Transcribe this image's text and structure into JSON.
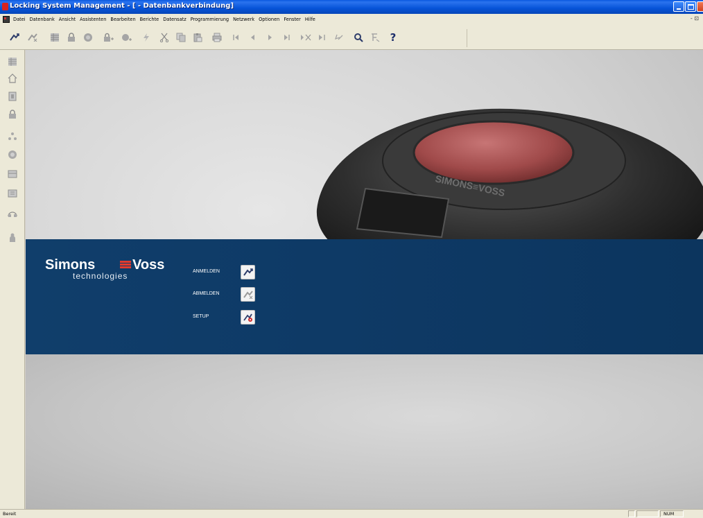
{
  "window": {
    "title": "Locking System Management - [ - Datenbankverbindung]"
  },
  "menu": {
    "items": [
      "Datei",
      "Datenbank",
      "Ansicht",
      "Assistenten",
      "Bearbeiten",
      "Berichte",
      "Datensatz",
      "Programmierung",
      "Netzwerk",
      "Optionen",
      "Fenster",
      "Hilfe"
    ],
    "window_controls": "- ⊡"
  },
  "toolbar": {
    "icons": [
      "login-icon",
      "logout-icon",
      "locking-plan-icon",
      "lock-icon",
      "transponder-icon",
      "new-lock-icon",
      "new-transponder-icon",
      "program-icon",
      "cut-icon",
      "copy-icon",
      "paste-icon",
      "print-icon",
      "first-record-icon",
      "previous-record-icon",
      "next-record-icon",
      "last-record-icon",
      "delete-record-icon",
      "apply-record-icon",
      "undo-icon",
      "search-icon",
      "filter-icon",
      "help-icon"
    ]
  },
  "sidebar": {
    "icons": [
      "locking-plan-icon",
      "home-icon",
      "door-icon",
      "lock-icon",
      "groups-icon",
      "transponder-icon",
      "time-zone-icon",
      "areas-icon",
      "network-icon",
      "person-icon"
    ]
  },
  "banner": {
    "brand_primary": "Simons",
    "brand_secondary": "Voss",
    "brand_sub": "technologies",
    "fob_text": "SIMONS≡VOSS",
    "actions": [
      {
        "label": "ANMELDEN",
        "icon": "login-icon"
      },
      {
        "label": "ABMELDEN",
        "icon": "logout-icon"
      },
      {
        "label": "SETUP",
        "icon": "setup-icon"
      }
    ]
  },
  "status": {
    "text": "Bereit",
    "num": "NUM"
  },
  "colors": {
    "banner": "#0e3a66",
    "brand_accent": "#e23b2e",
    "titlebar": "#0653d8"
  }
}
